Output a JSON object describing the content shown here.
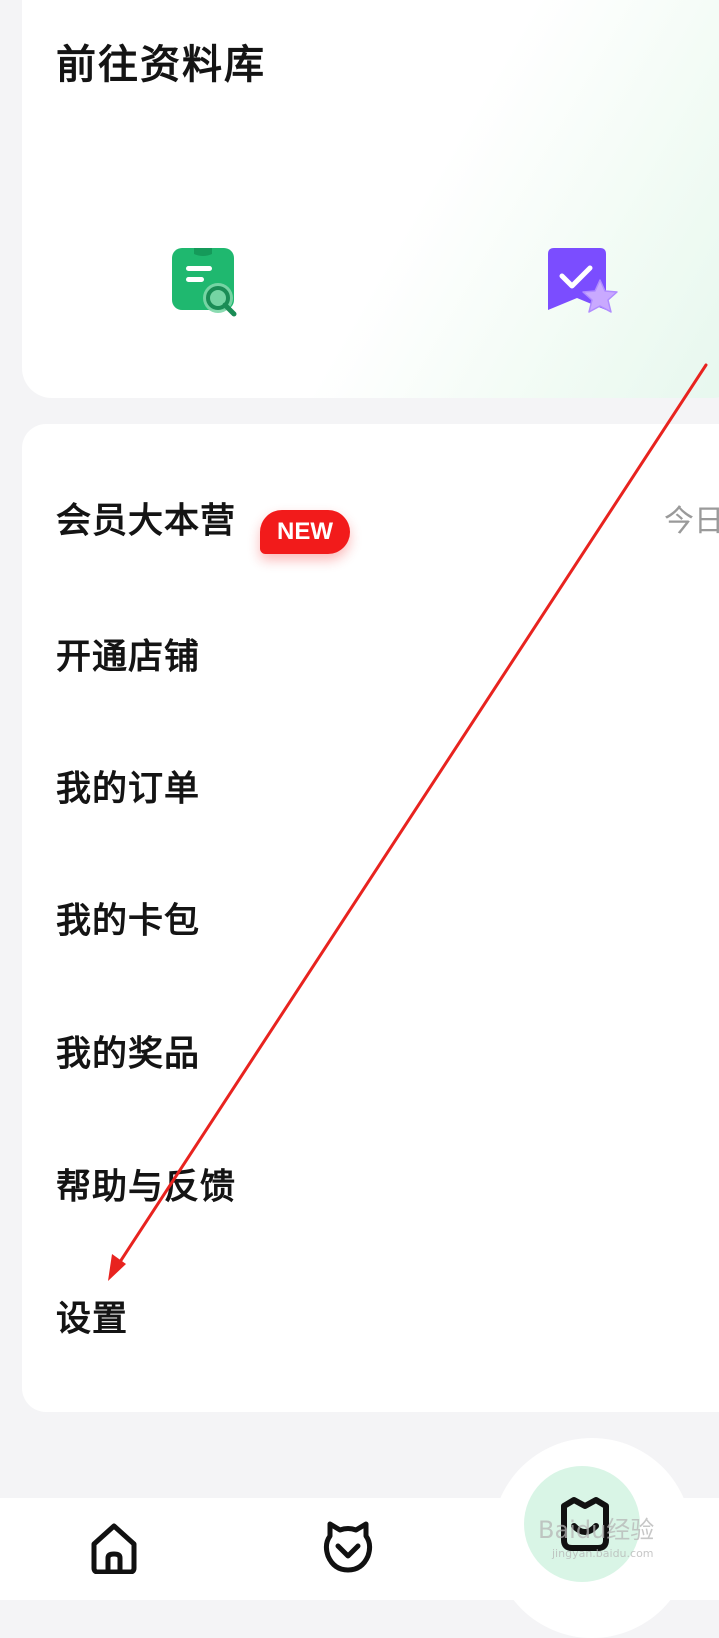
{
  "library": {
    "title": "前往资料库",
    "icons": [
      "document-search-icon",
      "favorite-star-icon"
    ]
  },
  "menu": {
    "items": [
      {
        "label": "会员大本营",
        "badge": "NEW",
        "side_text": "今日"
      },
      {
        "label": "开通店铺"
      },
      {
        "label": "我的订单"
      },
      {
        "label": "我的卡包"
      },
      {
        "label": "我的奖品"
      },
      {
        "label": "帮助与反馈"
      },
      {
        "label": "设置"
      }
    ]
  },
  "bottom_nav": {
    "tabs": [
      "home-icon",
      "discover-icon",
      "me-icon"
    ]
  },
  "watermark": {
    "text": "Baidu经验",
    "sub": "jingyan.baidu.com"
  },
  "colors": {
    "accent_green": "#1fb86f",
    "accent_purple": "#7b4dff",
    "badge_red": "#f21b1b",
    "annotation_red": "#e8231f"
  }
}
